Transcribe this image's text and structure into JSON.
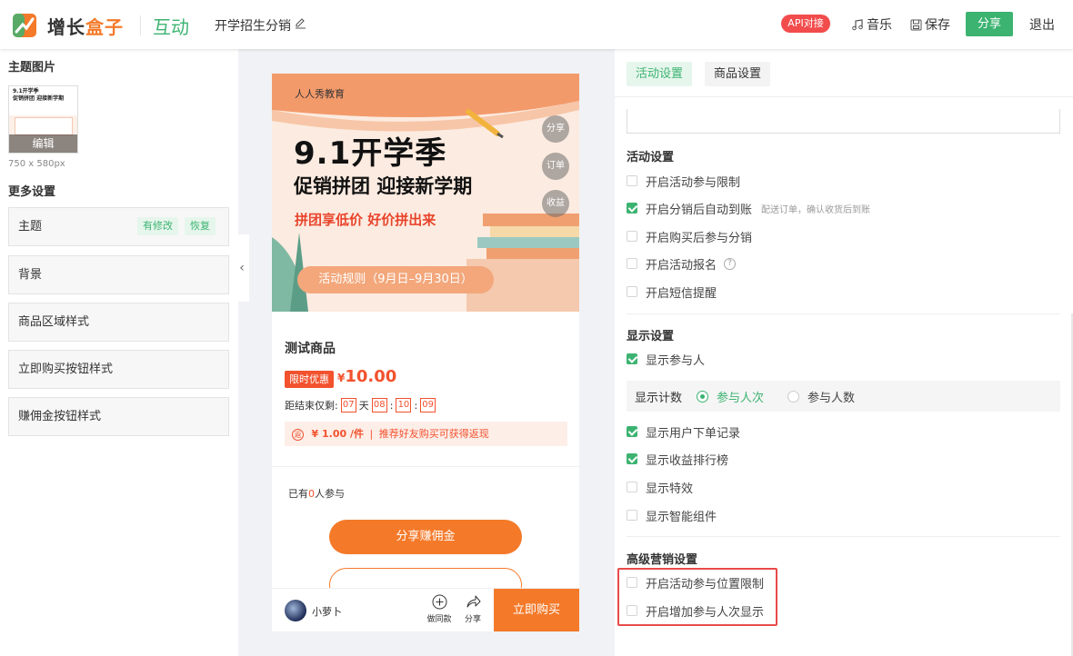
{
  "header": {
    "brand_part1": "增长",
    "brand_part2": "盒子",
    "module": "互动",
    "activity_name": "开学招生分销",
    "api_label": "API对接",
    "music_label": "音乐",
    "save_label": "保存",
    "share_label": "分享",
    "exit_label": "退出"
  },
  "left": {
    "theme_image_title": "主题图片",
    "thumb_edit": "编辑",
    "thumb_size": "750 x 580px",
    "more_settings_title": "更多设置",
    "items": [
      {
        "label": "主题",
        "tag_modified": "有修改",
        "tag_restore": "恢复"
      },
      {
        "label": "背景"
      },
      {
        "label": "商品区域样式"
      },
      {
        "label": "立即购买按钮样式"
      },
      {
        "label": "赚佣金按钮样式"
      }
    ]
  },
  "preview": {
    "org": "人人秀教育",
    "headline": "9.1开学季",
    "subheadline": "促销拼团  迎接新学期",
    "slogan": "拼团享低价 好价拼出来",
    "rules": "活动规则（9月日–9月30日）",
    "side_buttons": [
      "分享",
      "订单",
      "收益"
    ],
    "product_name": "测试商品",
    "flash_tag": "限时优惠",
    "price_symbol": "¥",
    "price": "10.00",
    "countdown_label": "距结束仅剩:",
    "countdown": {
      "days": "07",
      "day_unit": "天",
      "hours": "08",
      "minutes": "10",
      "seconds": "09",
      "sep": ":"
    },
    "promo_icon": "返",
    "promo_amount": "¥ 1.00 /件",
    "promo_sep": "|",
    "promo_text": "推荐好友购买可获得返现",
    "joined_prefix": "已有",
    "joined_count": "0",
    "joined_suffix": "人参与",
    "share_earn": "分享赚佣金",
    "shop_name": "小萝卜",
    "same_style": "做同款",
    "share": "分享",
    "buy_now": "立即购买"
  },
  "right": {
    "tabs": [
      "活动设置",
      "商品设置"
    ],
    "activity_section": "活动设置",
    "activity_options": [
      {
        "label": "开启活动参与限制",
        "checked": false
      },
      {
        "label": "开启分销后自动到账",
        "checked": true,
        "hint": "配送订单，确认收货后到账"
      },
      {
        "label": "开启购买后参与分销",
        "checked": false
      },
      {
        "label": "开启活动报名",
        "checked": false,
        "help": "?"
      },
      {
        "label": "开启短信提醒",
        "checked": false
      }
    ],
    "display_section": "显示设置",
    "display_participants": {
      "label": "显示参与人",
      "checked": true
    },
    "count_label": "显示计数",
    "count_options": [
      {
        "label": "参与人次",
        "selected": true
      },
      {
        "label": "参与人数",
        "selected": false
      }
    ],
    "display_options": [
      {
        "label": "显示用户下单记录",
        "checked": true
      },
      {
        "label": "显示收益排行榜",
        "checked": true
      },
      {
        "label": "显示特效",
        "checked": false
      },
      {
        "label": "显示智能组件",
        "checked": false
      }
    ],
    "advanced_section": "高级营销设置",
    "advanced_options": [
      {
        "label": "开启活动参与位置限制",
        "checked": false
      },
      {
        "label": "开启增加参与人次显示",
        "checked": false
      }
    ]
  },
  "colors": {
    "brand_green": "#3cb371",
    "brand_orange": "#f47a2a",
    "price_red": "#f2522e",
    "api_red": "#f24c4c",
    "highlight_border": "#e84b4b"
  },
  "icons": [
    "logo-icon",
    "edit-icon",
    "music-icon",
    "save-icon",
    "chevron-left-icon",
    "plus-circle-icon",
    "share-arrow-icon",
    "pencil-icon"
  ]
}
